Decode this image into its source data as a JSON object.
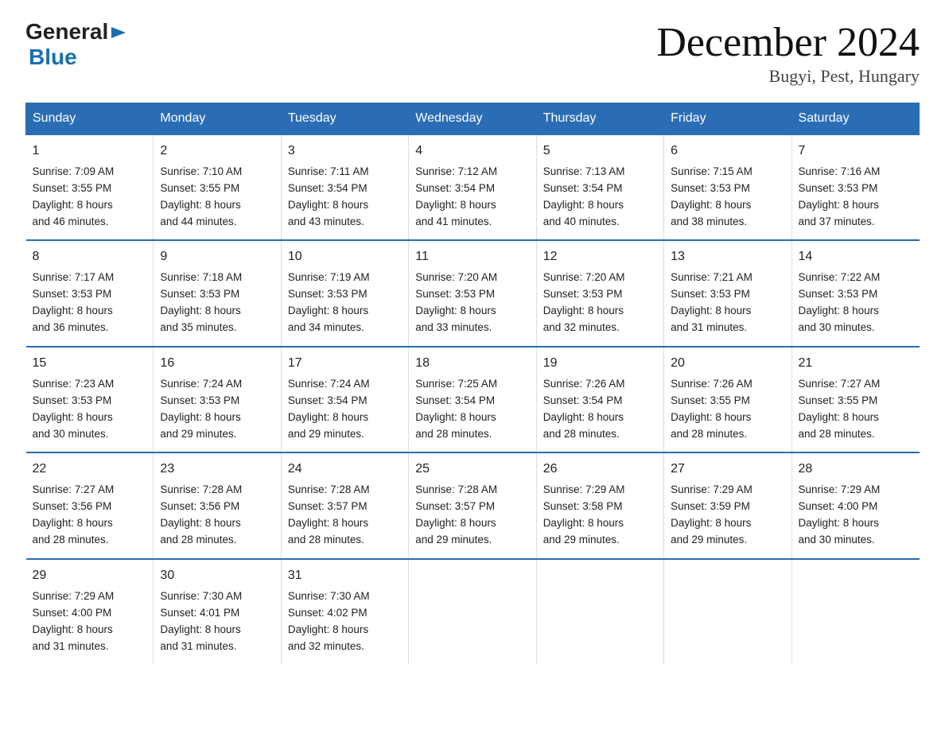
{
  "header": {
    "logo_general": "General",
    "logo_blue": "Blue",
    "page_title": "December 2024",
    "subtitle": "Bugyi, Pest, Hungary"
  },
  "columns": [
    "Sunday",
    "Monday",
    "Tuesday",
    "Wednesday",
    "Thursday",
    "Friday",
    "Saturday"
  ],
  "weeks": [
    [
      {
        "day": "1",
        "sunrise": "7:09 AM",
        "sunset": "3:55 PM",
        "daylight": "8 hours and 46 minutes."
      },
      {
        "day": "2",
        "sunrise": "7:10 AM",
        "sunset": "3:55 PM",
        "daylight": "8 hours and 44 minutes."
      },
      {
        "day": "3",
        "sunrise": "7:11 AM",
        "sunset": "3:54 PM",
        "daylight": "8 hours and 43 minutes."
      },
      {
        "day": "4",
        "sunrise": "7:12 AM",
        "sunset": "3:54 PM",
        "daylight": "8 hours and 41 minutes."
      },
      {
        "day": "5",
        "sunrise": "7:13 AM",
        "sunset": "3:54 PM",
        "daylight": "8 hours and 40 minutes."
      },
      {
        "day": "6",
        "sunrise": "7:15 AM",
        "sunset": "3:53 PM",
        "daylight": "8 hours and 38 minutes."
      },
      {
        "day": "7",
        "sunrise": "7:16 AM",
        "sunset": "3:53 PM",
        "daylight": "8 hours and 37 minutes."
      }
    ],
    [
      {
        "day": "8",
        "sunrise": "7:17 AM",
        "sunset": "3:53 PM",
        "daylight": "8 hours and 36 minutes."
      },
      {
        "day": "9",
        "sunrise": "7:18 AM",
        "sunset": "3:53 PM",
        "daylight": "8 hours and 35 minutes."
      },
      {
        "day": "10",
        "sunrise": "7:19 AM",
        "sunset": "3:53 PM",
        "daylight": "8 hours and 34 minutes."
      },
      {
        "day": "11",
        "sunrise": "7:20 AM",
        "sunset": "3:53 PM",
        "daylight": "8 hours and 33 minutes."
      },
      {
        "day": "12",
        "sunrise": "7:20 AM",
        "sunset": "3:53 PM",
        "daylight": "8 hours and 32 minutes."
      },
      {
        "day": "13",
        "sunrise": "7:21 AM",
        "sunset": "3:53 PM",
        "daylight": "8 hours and 31 minutes."
      },
      {
        "day": "14",
        "sunrise": "7:22 AM",
        "sunset": "3:53 PM",
        "daylight": "8 hours and 30 minutes."
      }
    ],
    [
      {
        "day": "15",
        "sunrise": "7:23 AM",
        "sunset": "3:53 PM",
        "daylight": "8 hours and 30 minutes."
      },
      {
        "day": "16",
        "sunrise": "7:24 AM",
        "sunset": "3:53 PM",
        "daylight": "8 hours and 29 minutes."
      },
      {
        "day": "17",
        "sunrise": "7:24 AM",
        "sunset": "3:54 PM",
        "daylight": "8 hours and 29 minutes."
      },
      {
        "day": "18",
        "sunrise": "7:25 AM",
        "sunset": "3:54 PM",
        "daylight": "8 hours and 28 minutes."
      },
      {
        "day": "19",
        "sunrise": "7:26 AM",
        "sunset": "3:54 PM",
        "daylight": "8 hours and 28 minutes."
      },
      {
        "day": "20",
        "sunrise": "7:26 AM",
        "sunset": "3:55 PM",
        "daylight": "8 hours and 28 minutes."
      },
      {
        "day": "21",
        "sunrise": "7:27 AM",
        "sunset": "3:55 PM",
        "daylight": "8 hours and 28 minutes."
      }
    ],
    [
      {
        "day": "22",
        "sunrise": "7:27 AM",
        "sunset": "3:56 PM",
        "daylight": "8 hours and 28 minutes."
      },
      {
        "day": "23",
        "sunrise": "7:28 AM",
        "sunset": "3:56 PM",
        "daylight": "8 hours and 28 minutes."
      },
      {
        "day": "24",
        "sunrise": "7:28 AM",
        "sunset": "3:57 PM",
        "daylight": "8 hours and 28 minutes."
      },
      {
        "day": "25",
        "sunrise": "7:28 AM",
        "sunset": "3:57 PM",
        "daylight": "8 hours and 29 minutes."
      },
      {
        "day": "26",
        "sunrise": "7:29 AM",
        "sunset": "3:58 PM",
        "daylight": "8 hours and 29 minutes."
      },
      {
        "day": "27",
        "sunrise": "7:29 AM",
        "sunset": "3:59 PM",
        "daylight": "8 hours and 29 minutes."
      },
      {
        "day": "28",
        "sunrise": "7:29 AM",
        "sunset": "4:00 PM",
        "daylight": "8 hours and 30 minutes."
      }
    ],
    [
      {
        "day": "29",
        "sunrise": "7:29 AM",
        "sunset": "4:00 PM",
        "daylight": "8 hours and 31 minutes."
      },
      {
        "day": "30",
        "sunrise": "7:30 AM",
        "sunset": "4:01 PM",
        "daylight": "8 hours and 31 minutes."
      },
      {
        "day": "31",
        "sunrise": "7:30 AM",
        "sunset": "4:02 PM",
        "daylight": "8 hours and 32 minutes."
      },
      {
        "day": "",
        "sunrise": "",
        "sunset": "",
        "daylight": ""
      },
      {
        "day": "",
        "sunrise": "",
        "sunset": "",
        "daylight": ""
      },
      {
        "day": "",
        "sunrise": "",
        "sunset": "",
        "daylight": ""
      },
      {
        "day": "",
        "sunrise": "",
        "sunset": "",
        "daylight": ""
      }
    ]
  ],
  "labels": {
    "sunrise_prefix": "Sunrise: ",
    "sunset_prefix": "Sunset: ",
    "daylight_prefix": "Daylight: "
  }
}
